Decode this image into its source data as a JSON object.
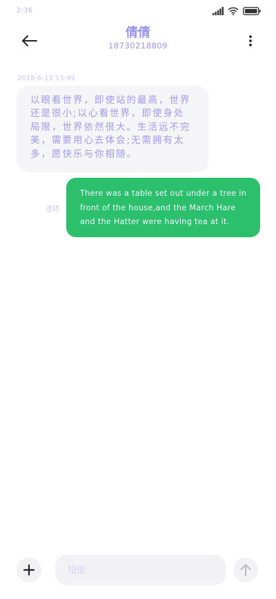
{
  "status_bar": {
    "time": "2:36",
    "icons": [
      "signal-icon",
      "wifi-icon",
      "battery-icon"
    ]
  },
  "header": {
    "contact_name": "倩倩",
    "contact_phone": "18730218809",
    "icons": [
      "arrow-left-icon",
      "more-vertical-icon"
    ]
  },
  "messages": [
    {
      "direction": "incoming",
      "timestamp": "2018-6-13 13:49",
      "text": "以眼看世界，即使站的最高，世界还是很小;以心看世界，即使身处局限，世界依然很大。生活远不完美，需要用心去体会;无需拥有太多，愿快乐与你相随。"
    },
    {
      "direction": "outgoing",
      "status": "送达",
      "text": "There was a table set out under a tree in front of the house,and the March Hare and the Hatter were having tea at it."
    }
  ],
  "input_bar": {
    "placeholder": "短信",
    "icons": [
      "plus-icon",
      "send-arrow-up-icon"
    ]
  },
  "colors": {
    "accent_text": "#9a95e9",
    "outgoing_bubble": "#2cbf6c",
    "incoming_bubble": "#f5f5f7"
  }
}
